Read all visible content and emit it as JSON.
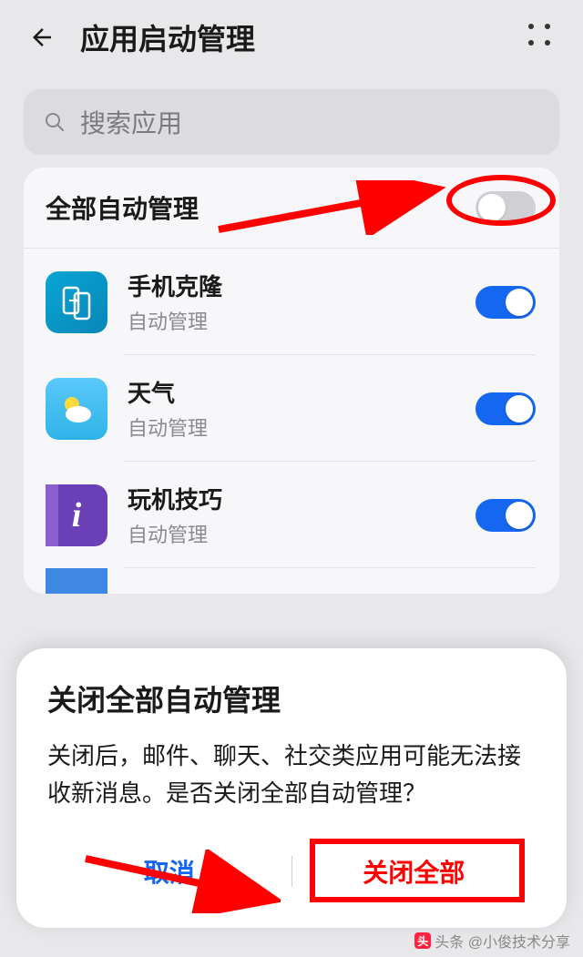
{
  "header": {
    "title": "应用启动管理"
  },
  "search": {
    "placeholder": "搜索应用"
  },
  "master": {
    "label": "全部自动管理",
    "enabled": false
  },
  "apps": [
    {
      "name": "手机克隆",
      "sub": "自动管理",
      "icon": "clone",
      "enabled": true
    },
    {
      "name": "天气",
      "sub": "自动管理",
      "icon": "weather",
      "enabled": true
    },
    {
      "name": "玩机技巧",
      "sub": "自动管理",
      "icon": "tips",
      "enabled": true
    }
  ],
  "dialog": {
    "title": "关闭全部自动管理",
    "body": "关闭后，邮件、聊天、社交类应用可能无法接收新消息。是否关闭全部自动管理？",
    "cancel": "取消",
    "confirm": "关闭全部"
  },
  "footer": {
    "credit": "头条 @小俊技术分享"
  },
  "colors": {
    "accent": "#1566f0",
    "danger": "#ff0000"
  }
}
